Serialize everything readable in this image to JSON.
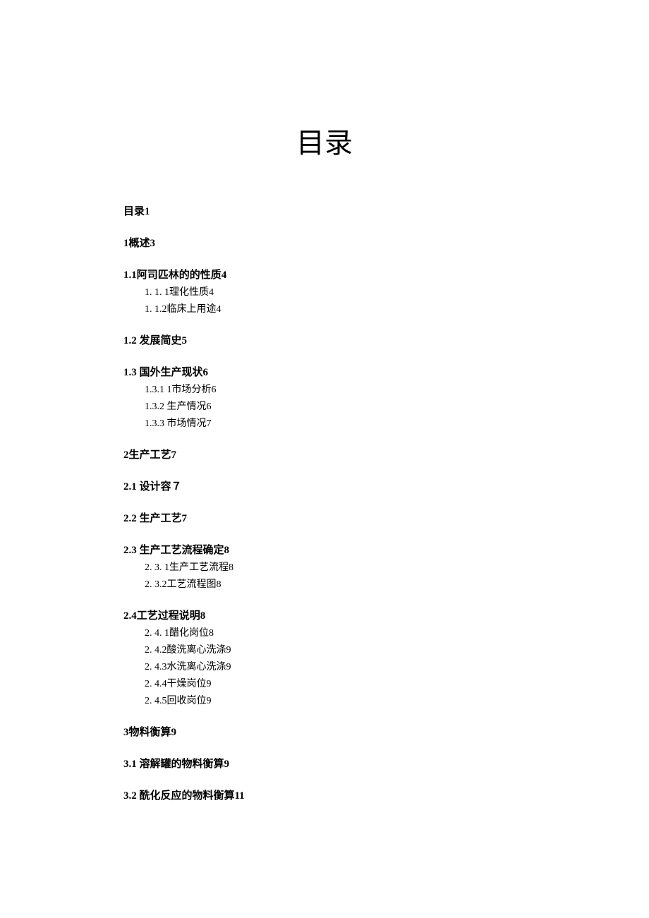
{
  "title": "目录",
  "entries": {
    "e0": "目录1",
    "e1": "1概述3",
    "e2": "1.1阿司匹林的的性质4",
    "e2a": "1. 1. 1理化性质4",
    "e2b": "1.   1.2临床上用途4",
    "e3": "1.2    发展简史5",
    "e4": "1.3    国外生产现状6",
    "e4a": "1.3.1   1市场分析6",
    "e4b": "1.3.2     生产情况6",
    "e4c": "1.3.3     市场情况7",
    "e5": "2生产工艺7",
    "e6": "2.1     设计容７",
    "e7": "2.2     生产工艺7",
    "e8": "2.3     生产工艺流程确定8",
    "e8a": "2. 3. 1生产工艺流程8",
    "e8b": "2. 3.2工艺流程图8",
    "e9": "2.4工艺过程说明8",
    "e9a": "2. 4. 1醋化岗位8",
    "e9b": "2. 4.2酸洗离心洗涤9",
    "e9c": "2. 4.3水洗离心洗涤9",
    "e9d": "2. 4.4干燥岗位9",
    "e9e": "2. 4.5回收岗位9",
    "e10": "3物料衡算9",
    "e11": "3.1     溶解罐的物料衡算9",
    "e12": "3.2     酰化反应的物料衡算11"
  }
}
